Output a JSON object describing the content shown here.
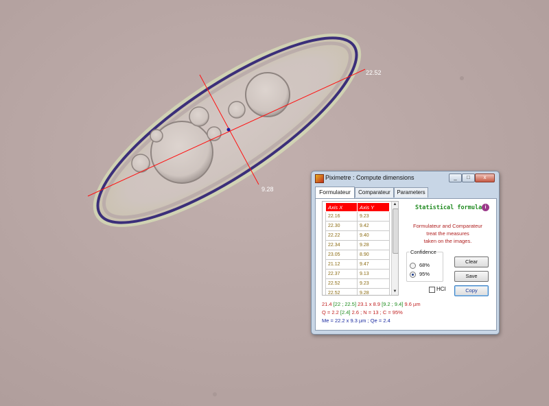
{
  "measurements": {
    "length_label": "22.52",
    "width_label": "9.28"
  },
  "window": {
    "title": "Piximetre : Compute dimensions",
    "controls": {
      "minimize": "_",
      "maximize": "□",
      "close": "x"
    }
  },
  "tabs": [
    {
      "label": "Formulateur",
      "active": true
    },
    {
      "label": "Comparateur",
      "active": false
    },
    {
      "label": "Parameters",
      "active": false
    }
  ],
  "table": {
    "headers": [
      "Axis X",
      "Axis Y"
    ],
    "rows": [
      [
        "22.16",
        "9.23"
      ],
      [
        "22.30",
        "9.42"
      ],
      [
        "22.22",
        "9.40"
      ],
      [
        "22.34",
        "9.28"
      ],
      [
        "23.05",
        "8.90"
      ],
      [
        "21.12",
        "9.47"
      ],
      [
        "22.37",
        "9.13"
      ],
      [
        "22.52",
        "9.23"
      ],
      [
        "22.52",
        "9.28"
      ]
    ]
  },
  "statistical_formula": "Statistical formula",
  "info_icon": "i",
  "description": [
    "Formulateur and Comparateur",
    "treat the measures",
    "taken on the images."
  ],
  "confidence": {
    "legend": "Confidence",
    "options": [
      {
        "label": "68%",
        "selected": false
      },
      {
        "label": "95%",
        "selected": true
      }
    ]
  },
  "buttons": {
    "clear": "Clear",
    "save": "Save",
    "copy": "Copy"
  },
  "hci": {
    "label": "HCI",
    "checked": false
  },
  "results": {
    "line1": {
      "a": "21.4 ",
      "b": "[22 ; 22.5]",
      "c": " 23.1 x 8.9 ",
      "d": "[9.2 ; 9.4]",
      "e": " 9.6 µm"
    },
    "line2": {
      "a": "Q = 2.2 ",
      "b": "[2.4]",
      "c": " 2.6 ; N = 13 ; C = 95%"
    },
    "line3": "Me = 22.2 x 9.3 µm ; Qe = 2.4"
  },
  "colors": {
    "accent_red": "#ff0000",
    "result_green": "#1a8a1a",
    "result_blue": "#1a2aa0"
  }
}
